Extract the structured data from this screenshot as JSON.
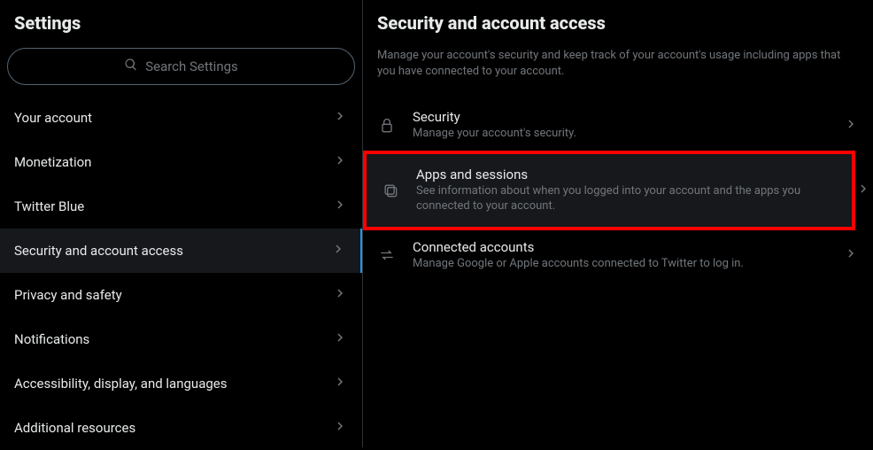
{
  "sidebar": {
    "title": "Settings",
    "search_placeholder": "Search Settings",
    "items": [
      {
        "label": "Your account",
        "active": false
      },
      {
        "label": "Monetization",
        "active": false
      },
      {
        "label": "Twitter Blue",
        "active": false
      },
      {
        "label": "Security and account access",
        "active": true
      },
      {
        "label": "Privacy and safety",
        "active": false
      },
      {
        "label": "Notifications",
        "active": false
      },
      {
        "label": "Accessibility, display, and languages",
        "active": false
      },
      {
        "label": "Additional resources",
        "active": false
      }
    ]
  },
  "main": {
    "title": "Security and account access",
    "description": "Manage your account's security and keep track of your account's usage including apps that you have connected to your account.",
    "options": [
      {
        "icon": "lock",
        "title": "Security",
        "subtitle": "Manage your account's security.",
        "highlighted": false
      },
      {
        "icon": "apps",
        "title": "Apps and sessions",
        "subtitle": "See information about when you logged into your account and the apps you connected to your account.",
        "highlighted": true
      },
      {
        "icon": "swap",
        "title": "Connected accounts",
        "subtitle": "Manage Google or Apple accounts connected to Twitter to log in.",
        "highlighted": false
      }
    ]
  }
}
